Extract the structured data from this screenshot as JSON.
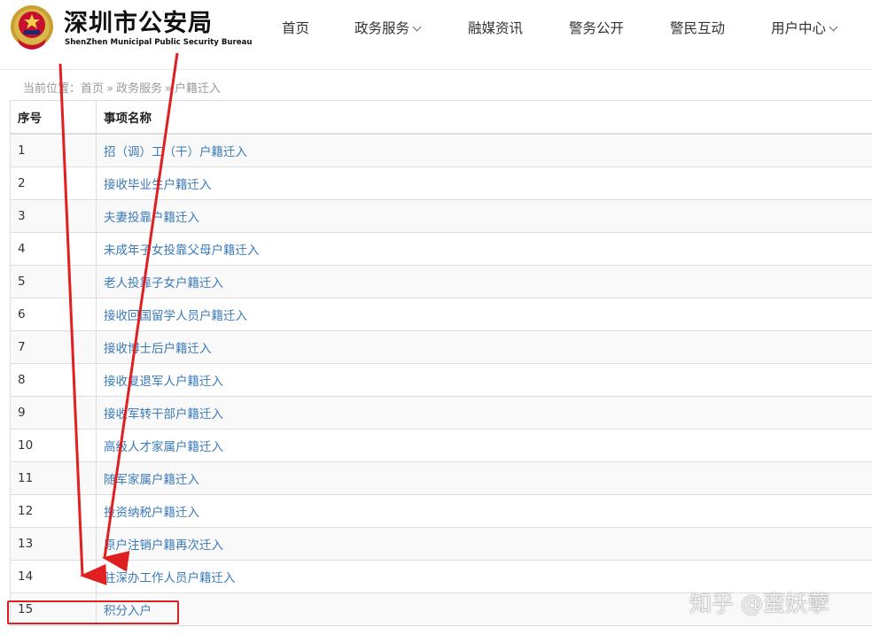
{
  "site": {
    "title_cn": "深圳市公安局",
    "title_en": "ShenZhen Municipal Public Security Bureau"
  },
  "nav": [
    {
      "label": "首页",
      "has_dropdown": false
    },
    {
      "label": "政务服务",
      "has_dropdown": true
    },
    {
      "label": "融媒资讯",
      "has_dropdown": false
    },
    {
      "label": "警务公开",
      "has_dropdown": false
    },
    {
      "label": "警民互动",
      "has_dropdown": false
    },
    {
      "label": "用户中心",
      "has_dropdown": true
    }
  ],
  "breadcrumb": {
    "prefix": "当前位置：",
    "items": [
      "首页",
      "政务服务",
      "户籍迁入"
    ],
    "separator": "»"
  },
  "table": {
    "headers": [
      "序号",
      "事项名称"
    ],
    "rows": [
      {
        "no": "1",
        "name": "招（调）工（干）户籍迁入"
      },
      {
        "no": "2",
        "name": "接收毕业生户籍迁入"
      },
      {
        "no": "3",
        "name": "夫妻投靠户籍迁入"
      },
      {
        "no": "4",
        "name": "未成年子女投靠父母户籍迁入"
      },
      {
        "no": "5",
        "name": "老人投靠子女户籍迁入"
      },
      {
        "no": "6",
        "name": "接收回国留学人员户籍迁入"
      },
      {
        "no": "7",
        "name": "接收博士后户籍迁入"
      },
      {
        "no": "8",
        "name": "接收复退军人户籍迁入"
      },
      {
        "no": "9",
        "name": "接收军转干部户籍迁入"
      },
      {
        "no": "10",
        "name": "高级人才家属户籍迁入"
      },
      {
        "no": "11",
        "name": "随军家属户籍迁入"
      },
      {
        "no": "12",
        "name": "投资纳税户籍迁入"
      },
      {
        "no": "13",
        "name": "原户注销户籍再次迁入"
      },
      {
        "no": "14",
        "name": "驻深办工作人员户籍迁入"
      },
      {
        "no": "15",
        "name": "积分入户"
      }
    ]
  },
  "watermark": "知乎 @蛮妖孽",
  "colors": {
    "link": "#3a7ab8",
    "annotation": "#e02020"
  }
}
